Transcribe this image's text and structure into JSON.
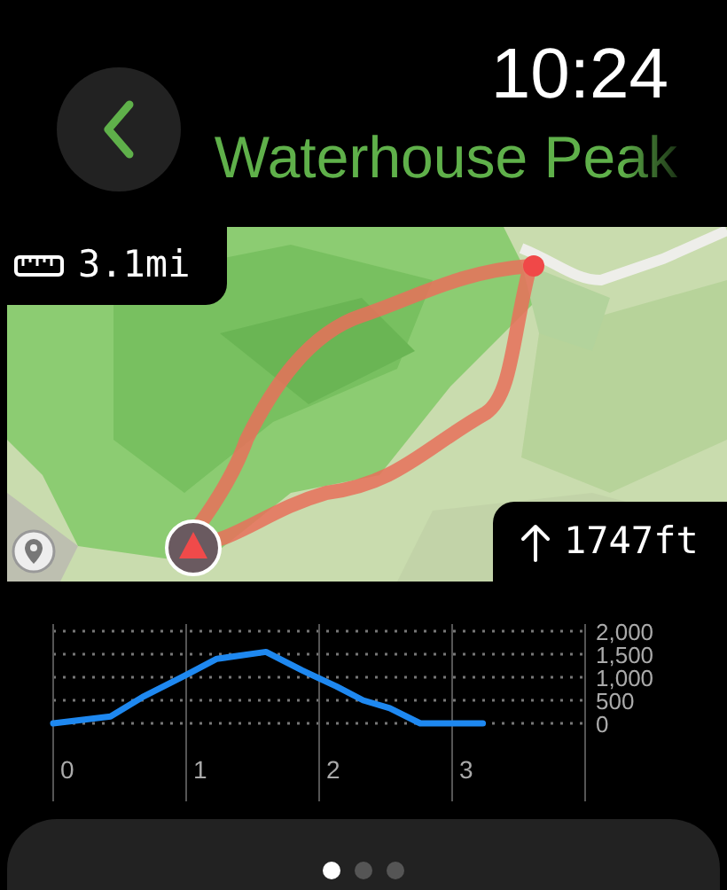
{
  "status": {
    "time": "10:24"
  },
  "header": {
    "title": "Waterhouse Peak"
  },
  "map": {
    "kind": "picture",
    "distance": "3.1mi",
    "elevation_gain": "1747ft"
  },
  "elevation": {
    "chart_data": {
      "type": "line",
      "x": [
        -0.1,
        0.33,
        0.57,
        0.9,
        1.13,
        1.5,
        1.77,
        2.03,
        2.23,
        2.43,
        2.66,
        3.13
      ],
      "series": [
        {
          "color": "#1e88f0",
          "values": [
            0,
            150,
            570,
            1050,
            1400,
            1550,
            1150,
            800,
            500,
            330,
            0,
            0
          ]
        }
      ],
      "grid": true,
      "xlim": [
        -0.1,
        3.9
      ],
      "ylim": [
        0,
        2000
      ],
      "xticks": [
        0,
        1,
        2,
        3
      ],
      "yticks": [
        {
          "value": 0,
          "label": "0"
        },
        {
          "value": 500,
          "label": "500"
        },
        {
          "value": 1000,
          "label": "1,000"
        },
        {
          "value": 1500,
          "label": "1,500"
        },
        {
          "value": 2000,
          "label": "2,000"
        }
      ]
    }
  },
  "pager": {
    "pages": [
      {
        "selected": true
      },
      {
        "selected": false
      },
      {
        "selected": false
      }
    ]
  }
}
